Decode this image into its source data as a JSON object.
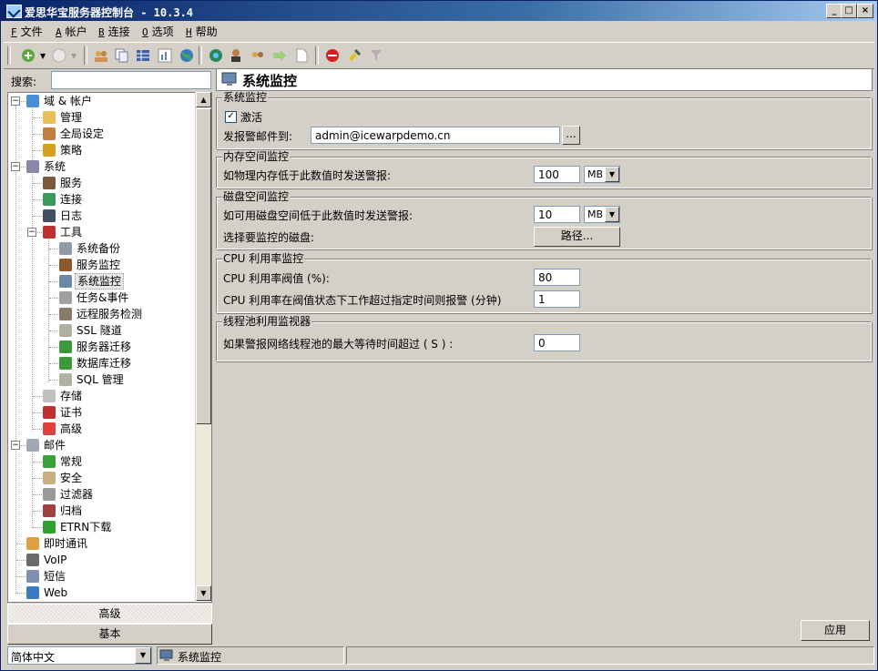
{
  "window": {
    "title": "爱思华宝服务器控制台 - 10.3.4"
  },
  "menu": [
    {
      "key": "F",
      "label": "文件"
    },
    {
      "key": "A",
      "label": "帐户"
    },
    {
      "key": "B",
      "label": "连接"
    },
    {
      "key": "O",
      "label": "选项"
    },
    {
      "key": "H",
      "label": "帮助"
    }
  ],
  "search": {
    "label": "搜索:",
    "value": ""
  },
  "tree": {
    "items": [
      {
        "label": "域 & 帐户",
        "icon": "globe-icon",
        "color": "#4a8fd6"
      },
      {
        "label": "管理",
        "icon": "folder-key-icon",
        "color": "#e8c05a"
      },
      {
        "label": "全局设定",
        "icon": "user-icon",
        "color": "#c08040"
      },
      {
        "label": "策略",
        "icon": "lock-icon",
        "color": "#d8a020"
      },
      {
        "label": "系统",
        "icon": "chart-icon",
        "color": "#8888aa"
      },
      {
        "label": "服务",
        "icon": "service-icon",
        "color": "#7a5a3a"
      },
      {
        "label": "连接",
        "icon": "globe-icon",
        "color": "#3a9a5a"
      },
      {
        "label": "日志",
        "icon": "monitor-icon",
        "color": "#405060"
      },
      {
        "label": "工具",
        "icon": "tools-icon",
        "color": "#c03030"
      },
      {
        "label": "系统备份",
        "icon": "disk-icon",
        "color": "#909aa8"
      },
      {
        "label": "服务监控",
        "icon": "dog-icon",
        "color": "#8a5a2a"
      },
      {
        "label": "系统监控",
        "icon": "monitor-icon",
        "color": "#6a8aa8"
      },
      {
        "label": "任务&事件",
        "icon": "clock-icon",
        "color": "#a0a0a0"
      },
      {
        "label": "远程服务检测",
        "icon": "paw-icon",
        "color": "#8a7a6a"
      },
      {
        "label": "SSL 隧道",
        "icon": "chart-icon",
        "color": "#b0b0a0"
      },
      {
        "label": "服务器迁移",
        "icon": "migrate-icon",
        "color": "#3a9a3a"
      },
      {
        "label": "数据库迁移",
        "icon": "db-migrate-icon",
        "color": "#3a9a3a"
      },
      {
        "label": "SQL 管理",
        "icon": "chart-icon",
        "color": "#b0b0a0"
      },
      {
        "label": "存储",
        "icon": "storage-icon",
        "color": "#c0c0c0"
      },
      {
        "label": "证书",
        "icon": "certificate-icon",
        "color": "#c03030"
      },
      {
        "label": "高级",
        "icon": "advanced-icon",
        "color": "#e04040"
      },
      {
        "label": "邮件",
        "icon": "mail-icon",
        "color": "#a0a8b8"
      },
      {
        "label": "常规",
        "icon": "arrow-right-icon",
        "color": "#3aa03a"
      },
      {
        "label": "安全",
        "icon": "shield-icon",
        "color": "#c8b080"
      },
      {
        "label": "过滤器",
        "icon": "funnel-icon",
        "color": "#9a9a9a"
      },
      {
        "label": "归档",
        "icon": "archive-icon",
        "color": "#a04040"
      },
      {
        "label": "ETRN下载",
        "icon": "arrow-down-icon",
        "color": "#30a030"
      },
      {
        "label": "即时通讯",
        "icon": "chat-icon",
        "color": "#e0a040"
      },
      {
        "label": "VoIP",
        "icon": "headset-icon",
        "color": "#6a6a6a"
      },
      {
        "label": "短信",
        "icon": "sms-icon",
        "color": "#8090b0"
      },
      {
        "label": "Web",
        "icon": "globe-icon",
        "color": "#3a7ac0"
      }
    ],
    "selected": "系统监控"
  },
  "bottom_tabs": {
    "advanced": "高级",
    "basic": "基本"
  },
  "status": {
    "language": "简体中文",
    "current": "系统监控"
  },
  "page": {
    "title": "系统监控",
    "system_monitor": {
      "legend": "系统监控",
      "activate_label": "激活",
      "activate_checked": true,
      "send_alert_label": "发报警邮件到:",
      "send_alert_value": "admin@icewarpdemo.cn",
      "browse_label": "..."
    },
    "memory": {
      "legend": "内存空间监控",
      "label": "如物理内存低于此数值时发送警报:",
      "value": "100",
      "unit": "MB"
    },
    "disk": {
      "legend": "磁盘空间监控",
      "label": "如可用磁盘空间低于此数值时发送警报:",
      "value": "10",
      "unit": "MB",
      "select_label": "选择要监控的磁盘:",
      "path_button": "路径..."
    },
    "cpu": {
      "legend": "CPU 利用率监控",
      "threshold_label": "CPU 利用率阀值 (%):",
      "threshold_value": "80",
      "duration_label": "CPU 利用率在阀值状态下工作超过指定时间则报警 (分钟)",
      "duration_value": "1"
    },
    "threadpool": {
      "legend": "线程池利用监视器",
      "label": "如果警报网络线程池的最大等待时间超过 ( S ) :",
      "value": "0"
    },
    "apply_button": "应用"
  }
}
